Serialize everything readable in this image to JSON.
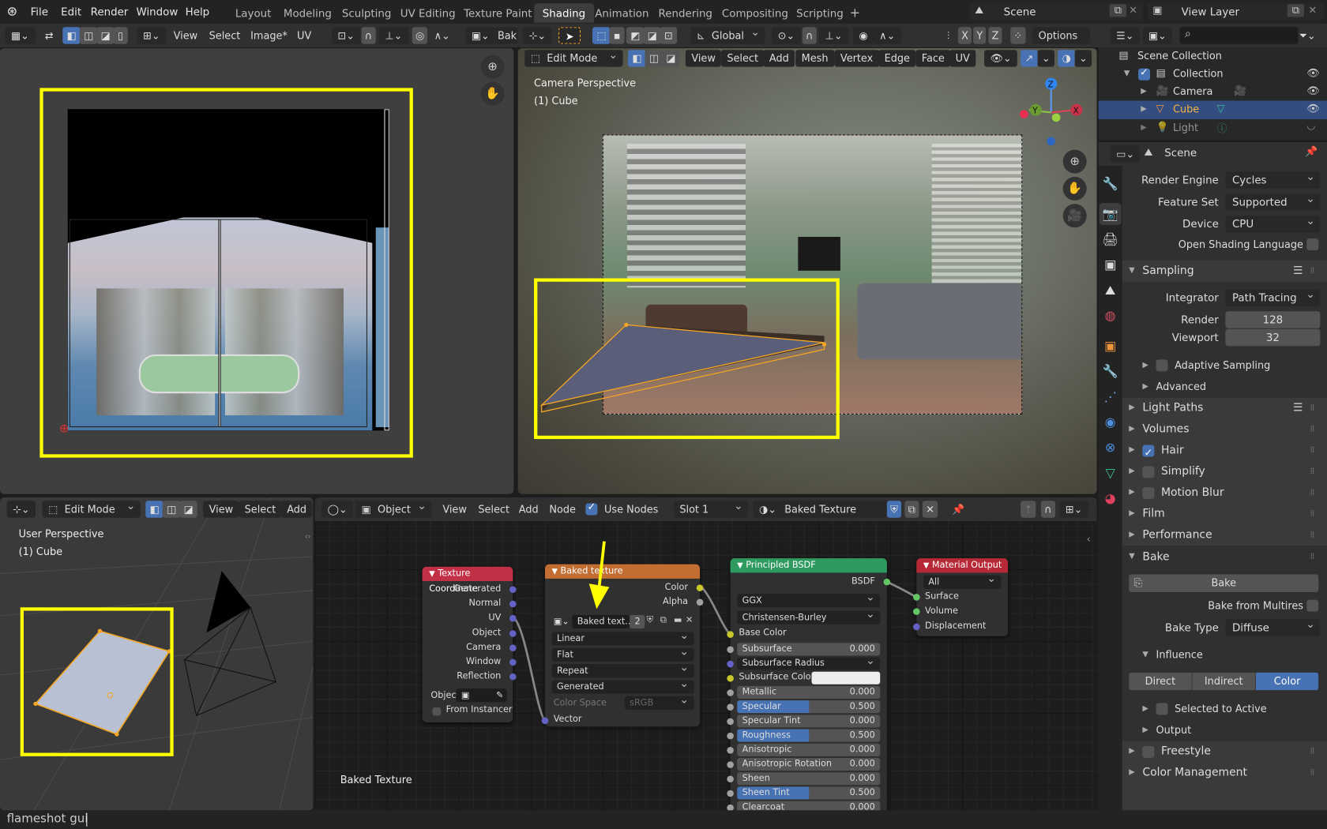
{
  "topbar": {
    "menus": [
      "File",
      "Edit",
      "Render",
      "Window",
      "Help"
    ],
    "workspaces": [
      "Layout",
      "Modeling",
      "Sculpting",
      "UV Editing",
      "Texture Paint",
      "Shading",
      "Animation",
      "Rendering",
      "Compositing",
      "Scripting"
    ],
    "active_workspace": "Shading",
    "add_workspace": "+",
    "scene": "Scene",
    "view_layer": "View Layer"
  },
  "image_editor": {
    "menus": [
      "View",
      "Select",
      "Image*",
      "UV"
    ],
    "image_name": "Bak"
  },
  "viewport_top": {
    "mode": "Edit Mode",
    "menus": [
      "View",
      "Select",
      "Add",
      "Mesh",
      "Vertex",
      "Edge",
      "Face",
      "UV"
    ],
    "orientation": "Global",
    "axes": [
      "X",
      "Y",
      "Z"
    ],
    "options": "Options",
    "overlay_title": "Camera Perspective",
    "overlay_object": "(1) Cube",
    "gizmo": {
      "z": "Z",
      "y": "Y",
      "x": "X"
    }
  },
  "outliner": {
    "scene_collection": "Scene Collection",
    "items": [
      {
        "name": "Collection",
        "type": "collection"
      },
      {
        "name": "Camera",
        "type": "camera"
      },
      {
        "name": "Cube",
        "type": "mesh",
        "selected": true
      },
      {
        "name": "Light",
        "type": "light"
      }
    ]
  },
  "properties": {
    "context": "Scene",
    "render_engine_label": "Render Engine",
    "render_engine": "Cycles",
    "feature_set_label": "Feature Set",
    "feature_set": "Supported",
    "device_label": "Device",
    "device": "CPU",
    "osl_label": "Open Shading Language",
    "osl": false,
    "sampling": {
      "title": "Sampling",
      "integrator_label": "Integrator",
      "integrator": "Path Tracing",
      "render_label": "Render",
      "render": "128",
      "viewport_label": "Viewport",
      "viewport": "32",
      "adaptive": "Adaptive Sampling",
      "advanced": "Advanced"
    },
    "panels": [
      {
        "label": "Light Paths",
        "checkbox": null
      },
      {
        "label": "Volumes",
        "checkbox": null
      },
      {
        "label": "Hair",
        "checkbox": true
      },
      {
        "label": "Simplify",
        "checkbox": false
      },
      {
        "label": "Motion Blur",
        "checkbox": false
      },
      {
        "label": "Film",
        "checkbox": null
      },
      {
        "label": "Performance",
        "checkbox": null
      }
    ],
    "bake": {
      "title": "Bake",
      "bake_button": "Bake",
      "from_multires_label": "Bake from Multires",
      "bake_type_label": "Bake Type",
      "bake_type": "Diffuse",
      "influence": "Influence",
      "influence_options": [
        "Direct",
        "Indirect",
        "Color"
      ],
      "influence_active": "Color",
      "selected_to_active": "Selected to Active",
      "output": "Output"
    },
    "freestyle": "Freestyle",
    "color_management": "Color Management"
  },
  "viewport_bottom": {
    "mode": "Edit Mode",
    "menus": [
      "View",
      "Select",
      "Add"
    ],
    "overlay_title": "User Perspective",
    "overlay_object": "(1) Cube"
  },
  "node_editor": {
    "object_type": "Object",
    "menus": [
      "View",
      "Select",
      "Add",
      "Node"
    ],
    "use_nodes_label": "Use Nodes",
    "use_nodes": true,
    "slot": "Slot 1",
    "material": "Baked Texture",
    "tree_label": "Baked Texture",
    "nodes": {
      "texcoord": {
        "title": "Texture Coordinate",
        "outputs": [
          "Generated",
          "Normal",
          "UV",
          "Object",
          "Camera",
          "Window",
          "Reflection"
        ],
        "object_label": "Object:",
        "from_instancer": "From Instancer"
      },
      "image": {
        "title": "Baked texture",
        "outputs": [
          "Color",
          "Alpha"
        ],
        "image_name": "Baked text...",
        "users": "2",
        "interpolation": "Linear",
        "projection": "Flat",
        "extension": "Repeat",
        "source": "Generated",
        "color_space_label": "Color Space",
        "color_space": "sRGB",
        "input": "Vector"
      },
      "bsdf": {
        "title": "Principled BSDF",
        "output": "BSDF",
        "distribution": "GGX",
        "subsurface_method": "Christensen-Burley",
        "base_color": "Base Color",
        "subsurface_radius": "Subsurface Radius",
        "subsurface_color": "Subsurface Color",
        "sliders": [
          {
            "label": "Subsurface",
            "value": "0.000",
            "fraction": 0
          },
          {
            "label": "Metallic",
            "value": "0.000",
            "fraction": 0
          },
          {
            "label": "Specular",
            "value": "0.500",
            "fraction": 0.5
          },
          {
            "label": "Specular Tint",
            "value": "0.000",
            "fraction": 0
          },
          {
            "label": "Roughness",
            "value": "0.500",
            "fraction": 0.5
          },
          {
            "label": "Anisotropic",
            "value": "0.000",
            "fraction": 0
          },
          {
            "label": "Anisotropic Rotation",
            "value": "0.000",
            "fraction": 0
          },
          {
            "label": "Sheen",
            "value": "0.000",
            "fraction": 0
          },
          {
            "label": "Sheen Tint",
            "value": "0.500",
            "fraction": 0.5
          },
          {
            "label": "Clearcoat",
            "value": "0.000",
            "fraction": 0
          }
        ]
      },
      "output": {
        "title": "Material Output",
        "target": "All",
        "inputs": [
          "Surface",
          "Volume",
          "Displacement"
        ]
      }
    }
  },
  "statusbar": {
    "command": "flameshot gui"
  },
  "colors": {
    "accent": "#4772b3",
    "highlight_yellow": "#ffff00",
    "selected_orange": "#f5a623",
    "node_texcoord": "#c23048",
    "node_image": "#c26d32",
    "node_bsdf": "#2e9a5f",
    "node_output": "#b82937"
  }
}
